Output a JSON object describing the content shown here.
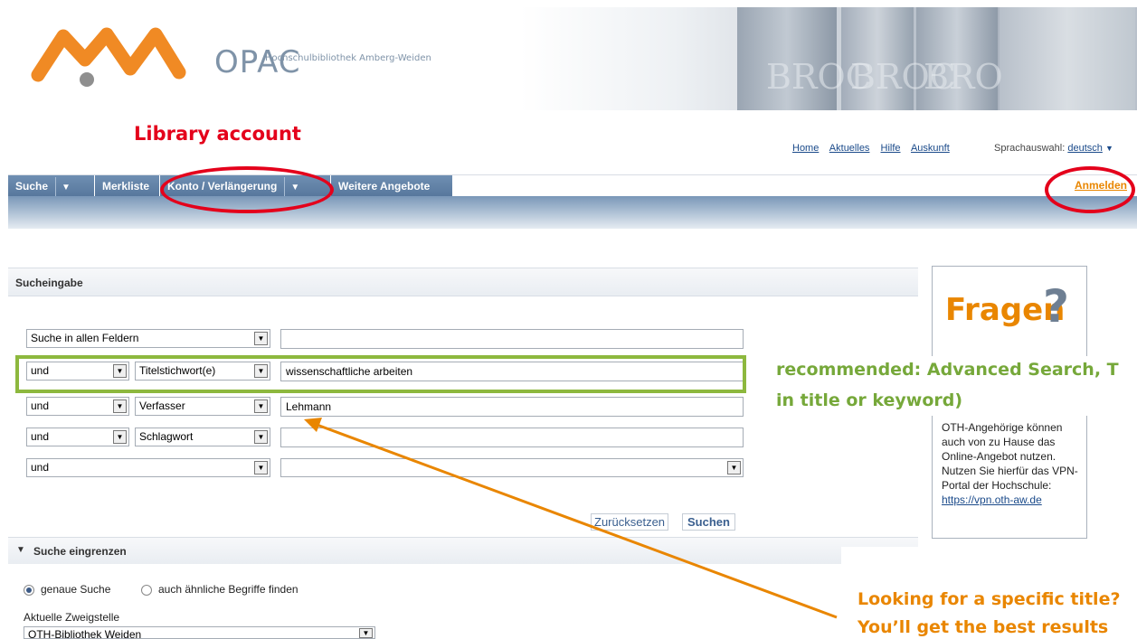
{
  "header": {
    "app_name": "OPAC",
    "subtitle": "Hochschulbibliothek Amberg-Weiden",
    "book_labels": [
      "BROC",
      "BROC",
      "BRO"
    ]
  },
  "annotations": {
    "library_account": "Library account",
    "recommended_line1": "recommended: Advanced Search, T",
    "recommended_line2": "in title or keyword)",
    "looking_line1": "Looking for a specific title?",
    "looking_line2": "You’ll get the best results"
  },
  "top_links": {
    "items": [
      "Home",
      "Aktuelles",
      "Hilfe",
      "Auskunft"
    ],
    "language_label": "Sprachauswahl:",
    "language_value": "deutsch"
  },
  "nav": {
    "tabs": [
      "Suche",
      "Merkliste",
      "Konto / Verlängerung",
      "Weitere Angebote"
    ],
    "login": "Anmelden"
  },
  "search": {
    "panel_title": "Sucheingabe",
    "rows": [
      {
        "operator": "",
        "field": "Suche in allen Feldern",
        "value": ""
      },
      {
        "operator": "und",
        "field": "Titelstichwort(e)",
        "value": "wissenschaftliche arbeiten"
      },
      {
        "operator": "und",
        "field": "Verfasser",
        "value": "Lehmann"
      },
      {
        "operator": "und",
        "field": "Schlagwort",
        "value": ""
      },
      {
        "operator": "und",
        "field": "",
        "value": ""
      }
    ],
    "reset_label": "Zurücksetzen",
    "search_label": "Suchen"
  },
  "narrow": {
    "title": "Suche eingrenzen",
    "radio_exact": "genaue Suche",
    "radio_similar": "auch ähnliche Begriffe finden",
    "branch_label": "Aktuelle Zweigstelle",
    "branch_value": "OTH-Bibliothek Weiden"
  },
  "sidebox": {
    "title": "Fragen",
    "qmark": "?",
    "text": "OTH-Angehörige können auch von zu Hause das Online-Angebot nutzen. Nutzen Sie hierfür das VPN-Portal der Hochschule: ",
    "link": "https://vpn.oth-aw.de"
  },
  "colors": {
    "annotation_red": "#e4001b",
    "annotation_green": "#76a83a",
    "annotation_orange": "#e98600",
    "nav_blue": "#5a7aa0"
  }
}
